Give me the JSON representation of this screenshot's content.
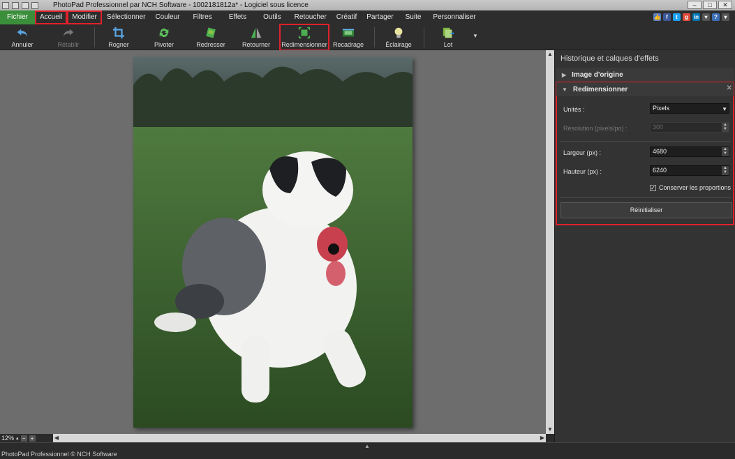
{
  "window": {
    "title": "PhotoPad Professionnel par NCH Software - 1002181812a* - Logiciel sous licence"
  },
  "menu": {
    "items": [
      "Fichier",
      "Accueil",
      "Modifier",
      "Sélectionner",
      "Couleur",
      "Filtres",
      "Effets",
      "Outils",
      "Retoucher",
      "Créatif",
      "Partager",
      "Suite",
      "Personnaliser"
    ]
  },
  "toolbar": {
    "undo": "Annuler",
    "redo": "Rétablir",
    "crop": "Rogner",
    "rotate": "Pivoter",
    "straighten": "Redresser",
    "flip": "Retourner",
    "resize": "Redimensionner",
    "recrop": "Recadrage",
    "lighting": "Éclairage",
    "batch": "Lot"
  },
  "panel": {
    "title": "Historique et calques d'effets",
    "original_layer": "Image d'origine",
    "resize_layer": "Redimensionner",
    "units_label": "Unités :",
    "units_value": "Pixels",
    "resolution_label": "Résolution (pixels/po) :",
    "resolution_value": "300",
    "width_label": "Largeur (px) :",
    "width_value": "4680",
    "height_label": "Hauteur (px) :",
    "height_value": "6240",
    "keep_ratio_label": "Conserver les proportions",
    "keep_ratio_checked": true,
    "reset_label": "Réinitialiser"
  },
  "zoom": {
    "level": "12%"
  },
  "status": {
    "text": "PhotoPad Professionnel © NCH Software"
  },
  "colors": {
    "accent_red": "#e0212c",
    "file_green": "#3b8f3b",
    "canvas_gray": "#6d6d6d"
  }
}
